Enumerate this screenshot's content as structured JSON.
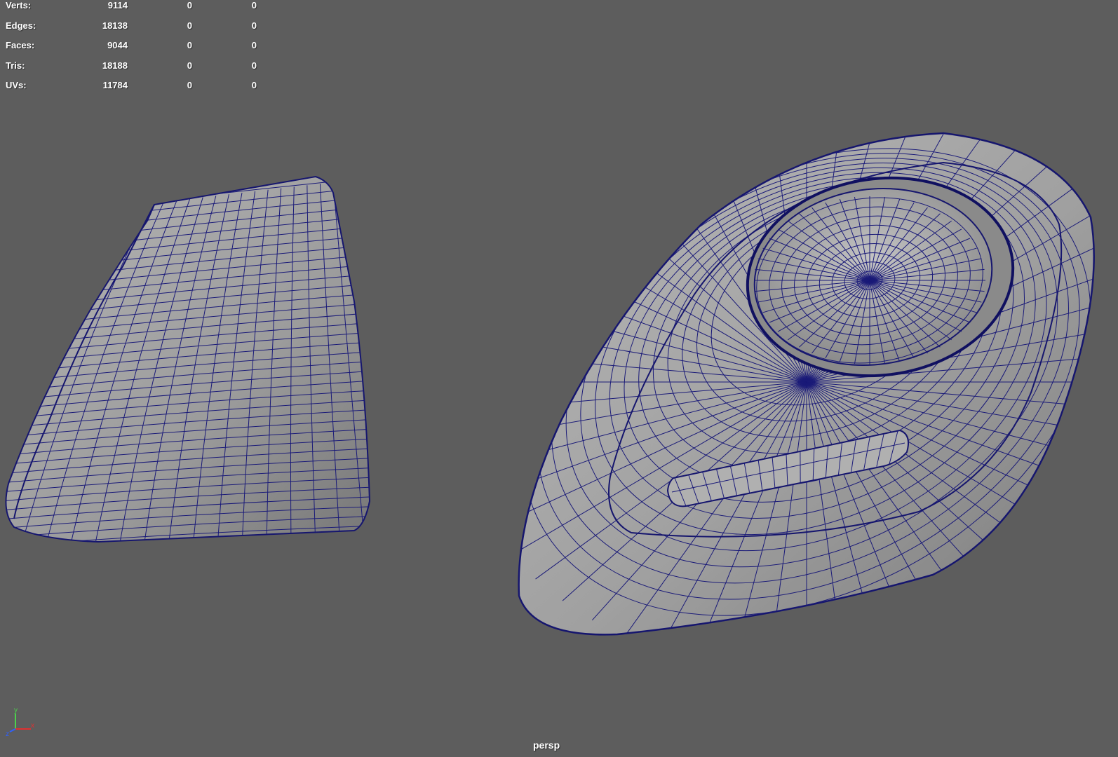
{
  "hud": {
    "rows": [
      {
        "label": "Verts:",
        "total": "9114",
        "selected": "0",
        "component": "0"
      },
      {
        "label": "Edges:",
        "total": "18138",
        "selected": "0",
        "component": "0"
      },
      {
        "label": "Faces:",
        "total": "9044",
        "selected": "0",
        "component": "0"
      },
      {
        "label": "Tris:",
        "total": "18188",
        "selected": "0",
        "component": "0"
      },
      {
        "label": "UVs:",
        "total": "11784",
        "selected": "0",
        "component": "0"
      }
    ]
  },
  "viewport": {
    "camera": "persp",
    "background": "#5d5d5d",
    "wire_color": "#16166e",
    "surface_color": "#a4a4a4"
  },
  "axis_indicator": {
    "y": "y",
    "z": "z",
    "x": "x"
  }
}
